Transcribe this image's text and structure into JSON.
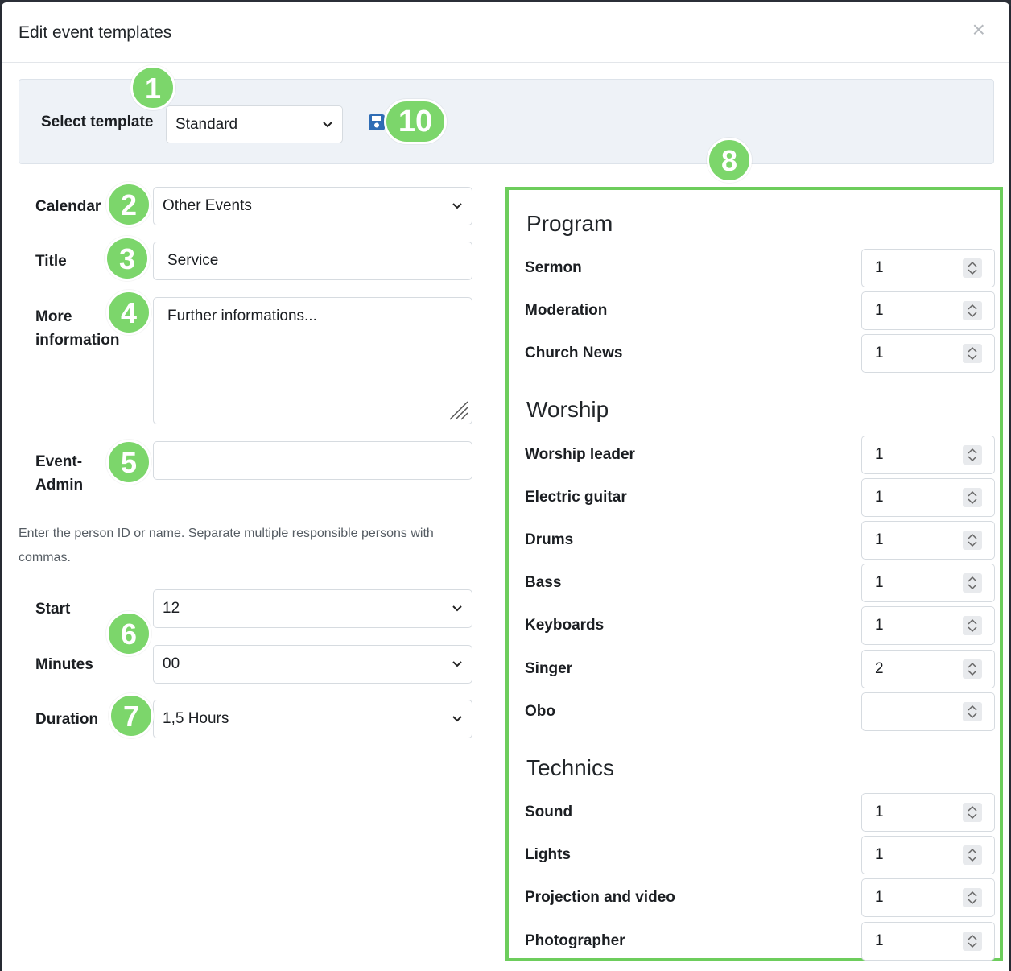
{
  "modal": {
    "title": "Edit event templates",
    "close": "×"
  },
  "template": {
    "label": "Select template",
    "selected": "Standard"
  },
  "form": {
    "calendar": {
      "label": "Calendar",
      "value": "Other Events"
    },
    "title": {
      "label": "Title",
      "value": "Service"
    },
    "more_info": {
      "label_line1": "More",
      "label_line2": "information",
      "value": "Further informations..."
    },
    "event_admin": {
      "label_line1": "Event-",
      "label_line2": "Admin",
      "value": ""
    },
    "help_text": "Enter the person ID or name. Separate multiple responsible persons with commas.",
    "start": {
      "label": "Start",
      "value": "12"
    },
    "minutes": {
      "label": "Minutes",
      "value": "00"
    },
    "duration": {
      "label": "Duration",
      "value": "1,5 Hours"
    }
  },
  "badges": [
    "1",
    "2",
    "3",
    "4",
    "5",
    "6",
    "7",
    "8",
    "10"
  ],
  "sections": [
    {
      "title": "Program",
      "items": [
        {
          "label": "Sermon",
          "value": "1"
        },
        {
          "label": "Moderation",
          "value": "1"
        },
        {
          "label": "Church News",
          "value": "1"
        }
      ]
    },
    {
      "title": "Worship",
      "items": [
        {
          "label": "Worship leader",
          "value": "1"
        },
        {
          "label": "Electric guitar",
          "value": "1"
        },
        {
          "label": "Drums",
          "value": "1"
        },
        {
          "label": "Bass",
          "value": "1"
        },
        {
          "label": "Keyboards",
          "value": "1"
        },
        {
          "label": "Singer",
          "value": "2"
        },
        {
          "label": "Obo",
          "value": ""
        }
      ]
    },
    {
      "title": "Technics",
      "items": [
        {
          "label": "Sound",
          "value": "1"
        },
        {
          "label": "Lights",
          "value": "1"
        },
        {
          "label": "Projection and video",
          "value": "1"
        },
        {
          "label": "Photographer",
          "value": "1"
        }
      ]
    }
  ],
  "colors": {
    "badge": "#7cd66b",
    "panel_border": "#6dcd5c",
    "save_icon": "#2f6db5"
  }
}
